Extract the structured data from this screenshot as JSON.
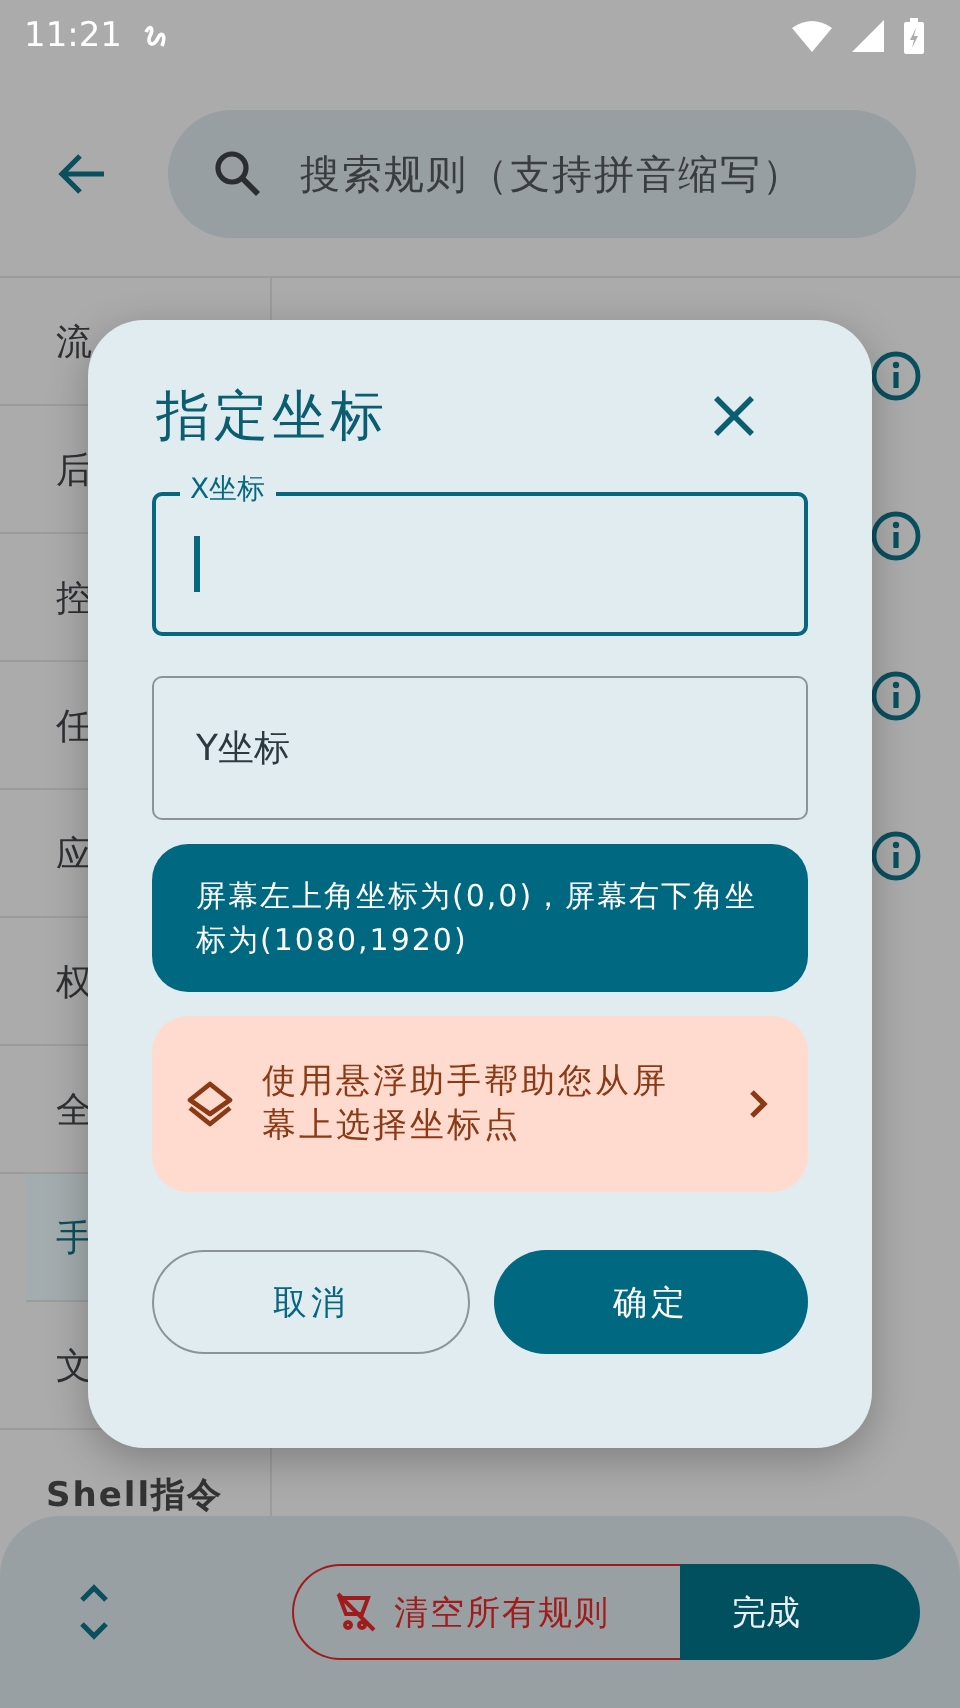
{
  "status_bar": {
    "time": "11:21"
  },
  "search": {
    "placeholder": "搜索规则（支持拼音缩写）"
  },
  "sidebar": {
    "items": [
      {
        "label": "流",
        "selected": false
      },
      {
        "label": "后",
        "selected": false
      },
      {
        "label": "控",
        "selected": false
      },
      {
        "label": "任",
        "selected": false
      },
      {
        "label": "应",
        "selected": false
      },
      {
        "label": "权",
        "selected": false
      },
      {
        "label": "全",
        "selected": false
      },
      {
        "label": "手",
        "selected": true
      },
      {
        "label": "文",
        "selected": false
      },
      {
        "label": "Shell指令",
        "selected": false
      }
    ]
  },
  "dialog": {
    "title": "指定坐标",
    "fields": [
      {
        "label": "X坐标",
        "focused": true
      },
      {
        "label": "Y坐标",
        "focused": false
      }
    ],
    "note": "屏幕左上角坐标为(0,0)，屏幕右下角坐标为(1080,1920)",
    "picker": {
      "label": "使用悬浮助手帮助您从屏幕上选择坐标点"
    },
    "buttons": [
      {
        "label": "取消",
        "kind": "outlined"
      },
      {
        "label": "确定",
        "kind": "filled"
      }
    ]
  },
  "bottom_bar": {
    "clear_button": "清空所有规则",
    "done_button": "完成"
  }
}
